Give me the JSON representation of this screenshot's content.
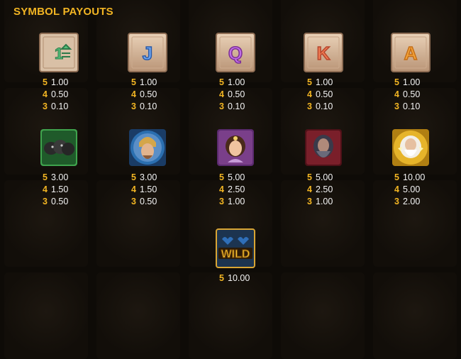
{
  "title": "SYMBOL PAYOUTS",
  "colors": {
    "gold": "#f2b523",
    "text": "#f4f4f4",
    "background": "#0e0b07"
  },
  "symbols": [
    {
      "icon": "ten-icon",
      "glyph": "10",
      "payouts": [
        {
          "count": "5",
          "value": "1.00"
        },
        {
          "count": "4",
          "value": "0.50"
        },
        {
          "count": "3",
          "value": "0.10"
        }
      ]
    },
    {
      "icon": "jack-icon",
      "glyph": "J",
      "payouts": [
        {
          "count": "5",
          "value": "1.00"
        },
        {
          "count": "4",
          "value": "0.50"
        },
        {
          "count": "3",
          "value": "0.10"
        }
      ]
    },
    {
      "icon": "queen-icon",
      "glyph": "Q",
      "payouts": [
        {
          "count": "5",
          "value": "1.00"
        },
        {
          "count": "4",
          "value": "0.50"
        },
        {
          "count": "3",
          "value": "0.10"
        }
      ]
    },
    {
      "icon": "king-icon",
      "glyph": "K",
      "payouts": [
        {
          "count": "5",
          "value": "1.00"
        },
        {
          "count": "4",
          "value": "0.50"
        },
        {
          "count": "3",
          "value": "0.10"
        }
      ]
    },
    {
      "icon": "ace-icon",
      "glyph": "A",
      "payouts": [
        {
          "count": "5",
          "value": "1.00"
        },
        {
          "count": "4",
          "value": "0.50"
        },
        {
          "count": "3",
          "value": "0.10"
        }
      ]
    },
    {
      "icon": "black-horses-icon",
      "payouts": [
        {
          "count": "5",
          "value": "3.00"
        },
        {
          "count": "4",
          "value": "1.50"
        },
        {
          "count": "3",
          "value": "0.50"
        }
      ]
    },
    {
      "icon": "helmeted-warrior-icon",
      "payouts": [
        {
          "count": "5",
          "value": "3.00"
        },
        {
          "count": "4",
          "value": "1.50"
        },
        {
          "count": "3",
          "value": "0.50"
        }
      ]
    },
    {
      "icon": "goddess-icon",
      "payouts": [
        {
          "count": "5",
          "value": "5.00"
        },
        {
          "count": "4",
          "value": "2.50"
        },
        {
          "count": "3",
          "value": "1.00"
        }
      ]
    },
    {
      "icon": "dark-god-icon",
      "payouts": [
        {
          "count": "5",
          "value": "5.00"
        },
        {
          "count": "4",
          "value": "2.50"
        },
        {
          "count": "3",
          "value": "1.00"
        }
      ]
    },
    {
      "icon": "zeus-icon",
      "payouts": [
        {
          "count": "5",
          "value": "10.00"
        },
        {
          "count": "4",
          "value": "5.00"
        },
        {
          "count": "3",
          "value": "2.00"
        }
      ]
    },
    {
      "icon": "wild-icon",
      "glyph": "WILD",
      "payouts": [
        {
          "count": "5",
          "value": "10.00"
        }
      ]
    }
  ]
}
